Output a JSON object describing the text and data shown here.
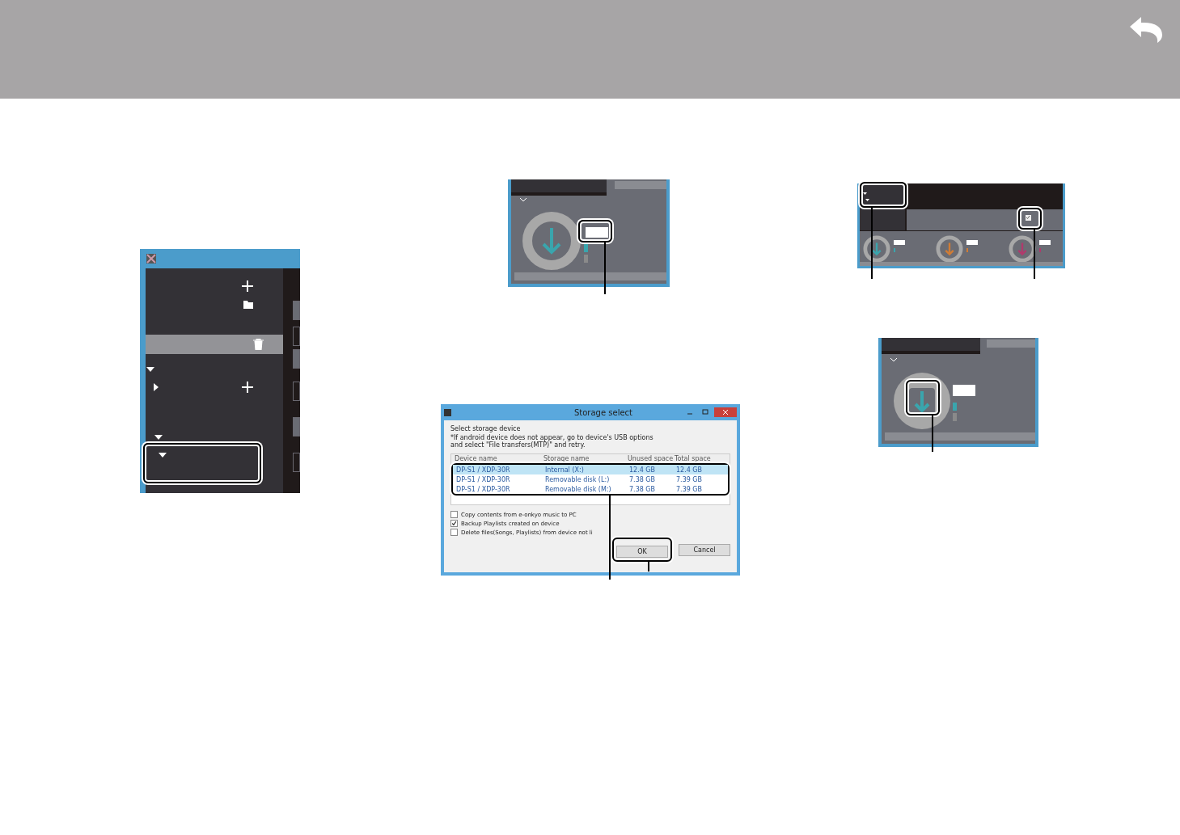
{
  "library_panel": {
    "rows": [
      {
        "selected": false
      },
      {
        "selected": false
      },
      {
        "selected": true
      },
      {
        "selected": false
      }
    ],
    "nodes": [
      {
        "expanded": true
      },
      {
        "expanded": false
      },
      {
        "expanded": true
      },
      {
        "expanded": true
      }
    ]
  },
  "transfer_panel": {
    "checkbox_checked": true
  },
  "storage_dialog": {
    "title": "Storage select",
    "heading": "Select storage device",
    "note": [
      "*If android device does not appear, go to device's USB options",
      "and select \"File transfers(MTP)\" and retry."
    ],
    "columns": [
      "Device name",
      "Storage name",
      "Unused space",
      "Total space"
    ],
    "rows": [
      {
        "device": "DP-S1 / XDP-30R",
        "storage": "Internal (X:)",
        "unused": "12.4 GB",
        "total": "12.4 GB",
        "selected": true
      },
      {
        "device": "DP-S1 / XDP-30R",
        "storage": "Removable disk (L:)",
        "unused": "7.38 GB",
        "total": "7.39 GB",
        "selected": false
      },
      {
        "device": "DP-S1 / XDP-30R",
        "storage": "Removable disk (M:)",
        "unused": "7.38 GB",
        "total": "7.39 GB",
        "selected": false
      }
    ],
    "options": [
      {
        "label": "Copy contents from e-onkyo music to PC",
        "checked": false
      },
      {
        "label": "Backup Playlists created on device",
        "checked": true
      },
      {
        "label": "Delete files(Songs, Playlists) from device not li",
        "checked": false
      }
    ],
    "buttons": [
      "OK",
      "Cancel"
    ]
  }
}
